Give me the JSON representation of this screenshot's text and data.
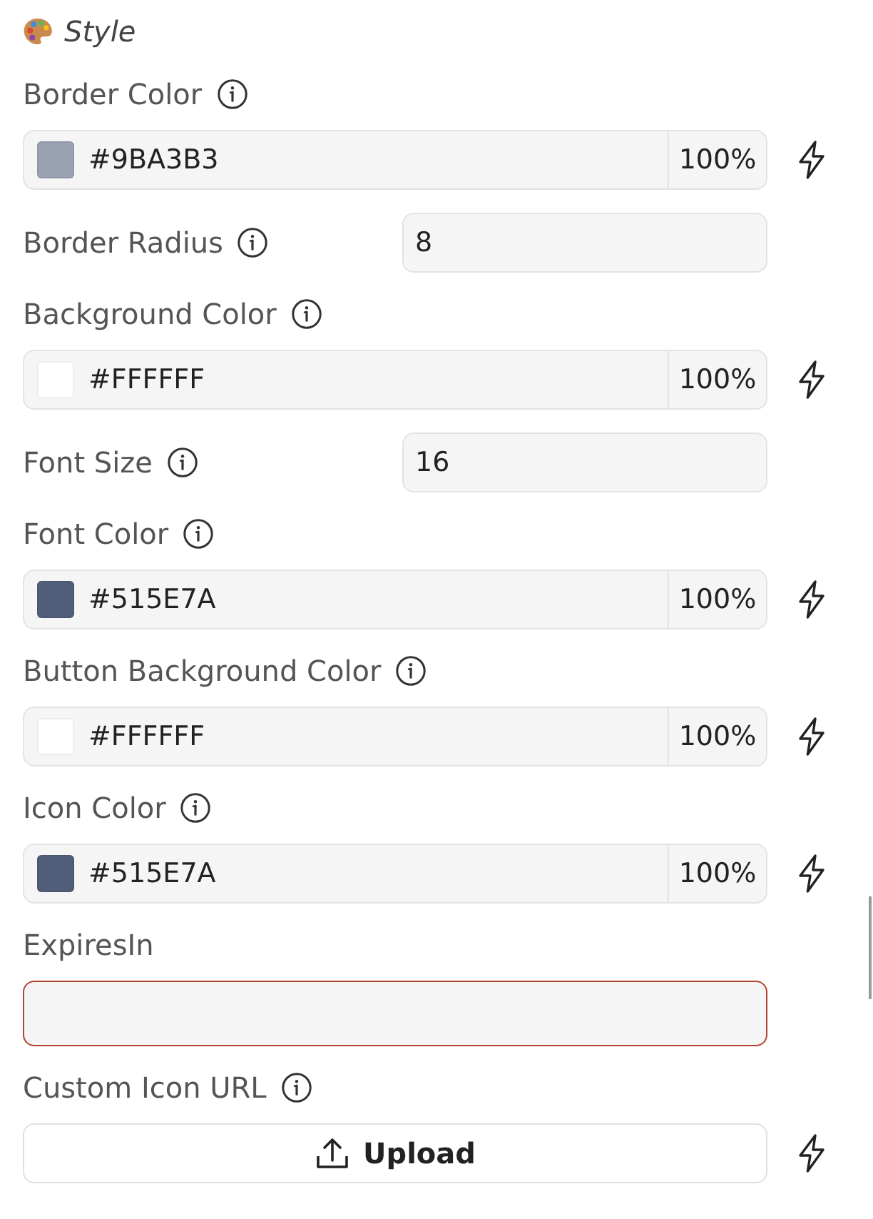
{
  "section": {
    "title": "Style"
  },
  "fields": [
    {
      "kind": "color",
      "label": "Border Color",
      "info": true,
      "value": "#9BA3B3",
      "color": "#9ba3b3",
      "opacity": "100%",
      "dynamic": true
    },
    {
      "kind": "number",
      "label": "Border Radius",
      "info": true,
      "value": "8",
      "invalid": false,
      "dynamic": false
    },
    {
      "kind": "color",
      "label": "Background Color",
      "info": true,
      "value": "#FFFFFF",
      "color": "#ffffff",
      "opacity": "100%",
      "dynamic": true
    },
    {
      "kind": "number",
      "label": "Font Size",
      "info": true,
      "value": "16",
      "invalid": false,
      "dynamic": false
    },
    {
      "kind": "color",
      "label": "Font Color",
      "info": true,
      "value": "#515E7A",
      "color": "#515e7a",
      "opacity": "100%",
      "dynamic": true
    },
    {
      "kind": "color",
      "label": "Button Background Color",
      "info": true,
      "value": "#FFFFFF",
      "color": "#ffffff",
      "opacity": "100%",
      "dynamic": true
    },
    {
      "kind": "color",
      "label": "Icon Color",
      "info": true,
      "value": "#515E7A",
      "color": "#515e7a",
      "opacity": "100%",
      "dynamic": true
    },
    {
      "kind": "text",
      "label": "ExpiresIn",
      "info": false,
      "invalid": true,
      "dynamic": false
    },
    {
      "kind": "upload",
      "label": "Custom Icon URL",
      "info": true,
      "button": "Upload",
      "dynamic": true
    }
  ]
}
